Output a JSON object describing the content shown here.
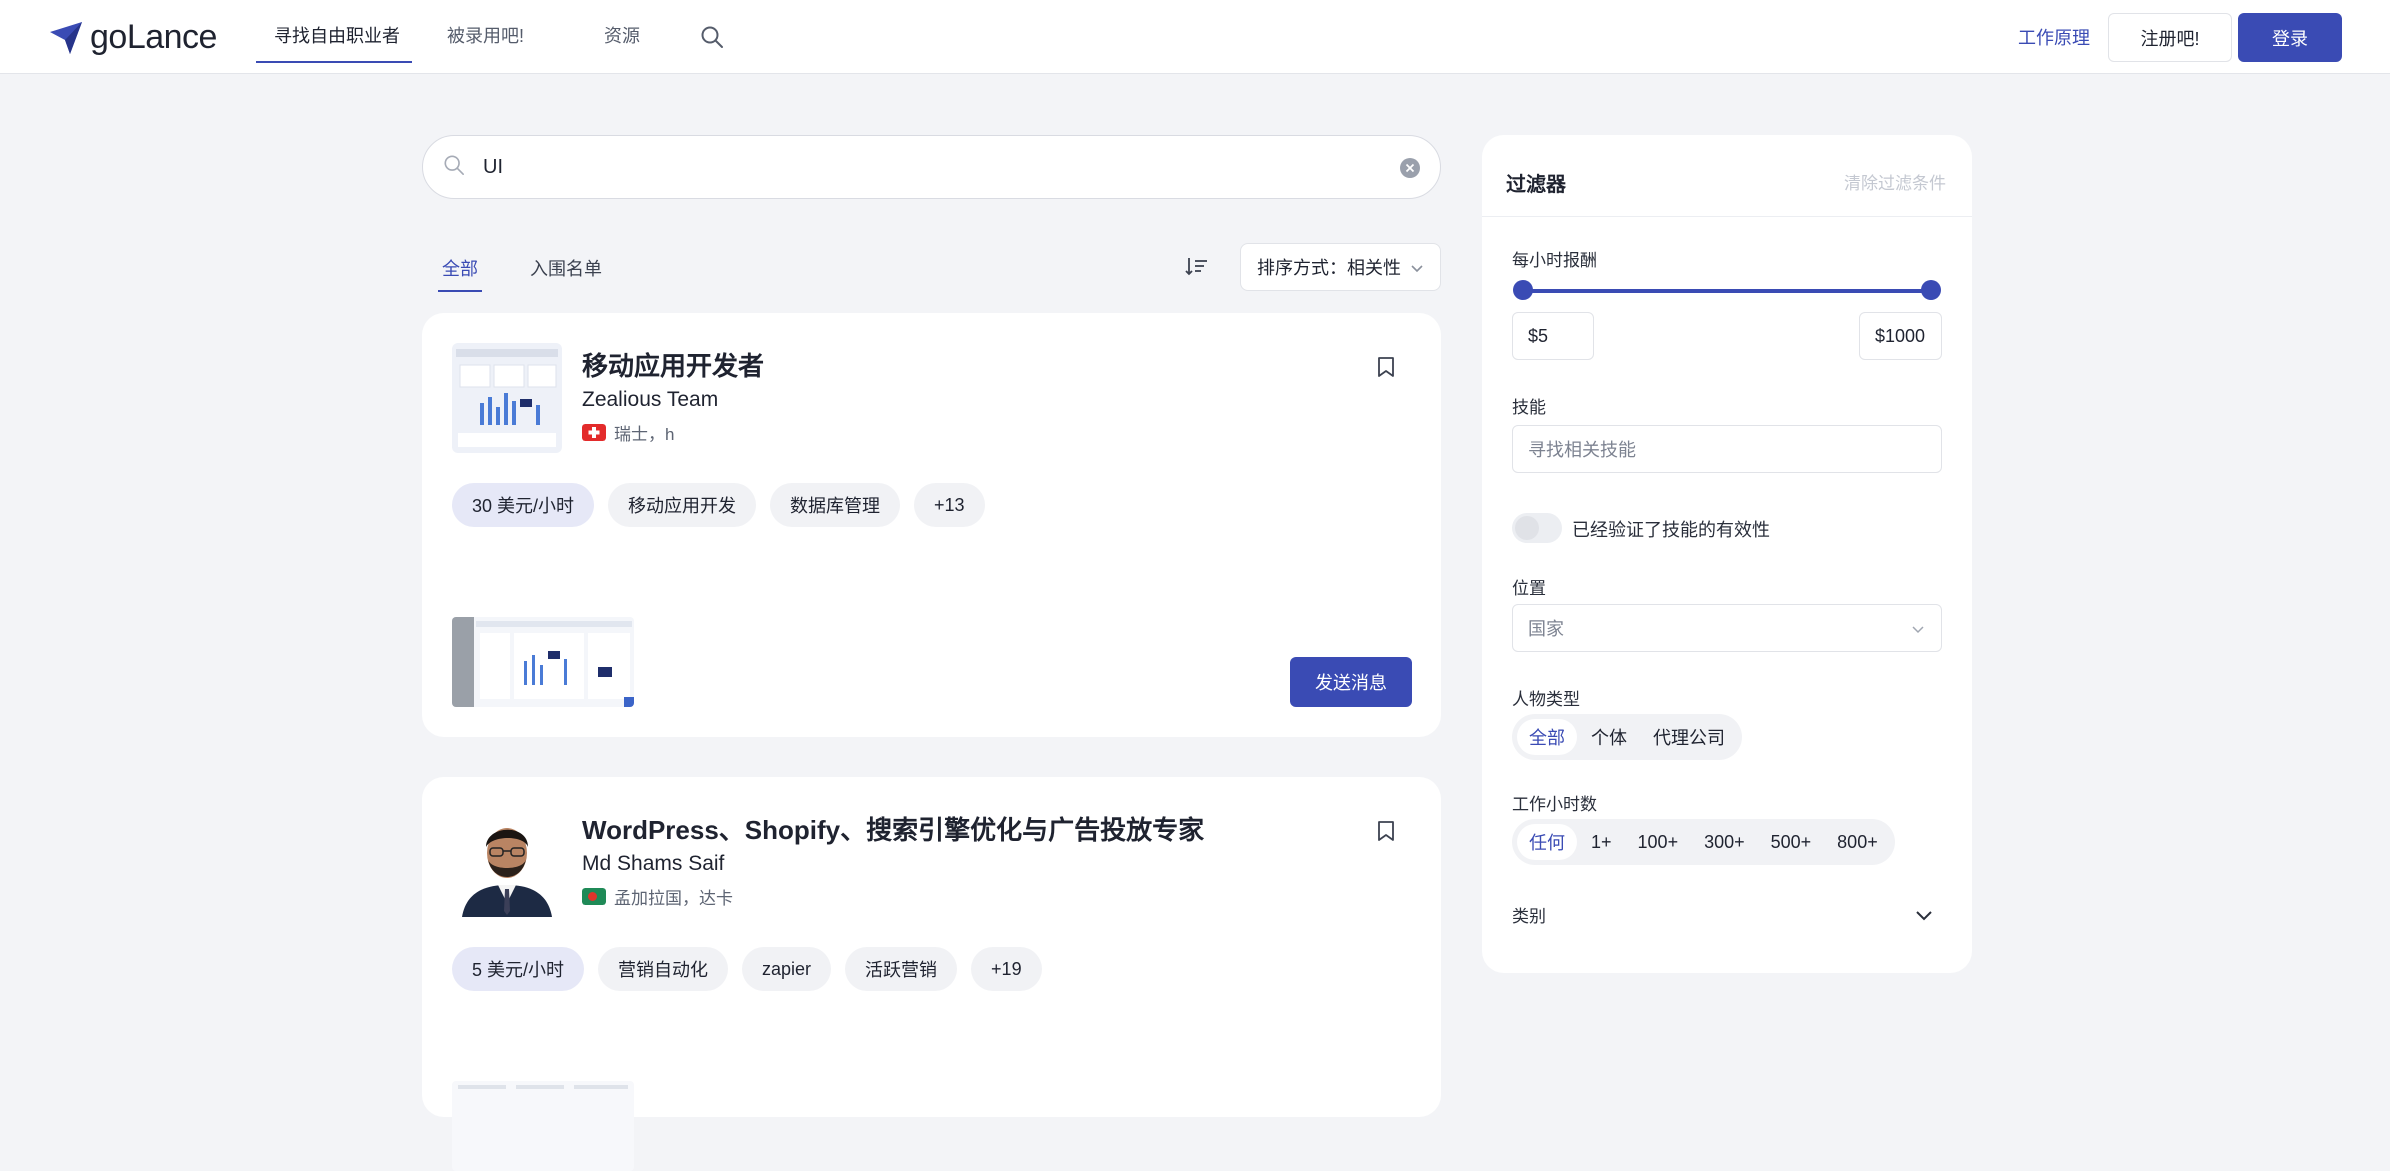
{
  "header": {
    "logo_text": "goLance",
    "nav": [
      "寻找自由职业者",
      "被录用吧!",
      "资源"
    ],
    "how_it_works": "工作原理",
    "register": "注册吧!",
    "login": "登录"
  },
  "search": {
    "value": "UI"
  },
  "tabs": [
    "全部",
    "入围名单"
  ],
  "sort": {
    "label": "排序方式：相关性"
  },
  "cards": [
    {
      "title": "移动应用开发者",
      "name": "Zealious Team",
      "location": "瑞士，h",
      "chips": [
        "30 美元/小时",
        "移动应用开发",
        "数据库管理",
        "+13"
      ],
      "message_button": "发送消息"
    },
    {
      "title": "WordPress、Shopify、搜索引擎优化与广告投放专家",
      "name": "Md Shams Saif",
      "location": "孟加拉国，达卡",
      "chips": [
        "5 美元/小时",
        "营销自动化",
        "zapier",
        "活跃营销",
        "+19"
      ]
    }
  ],
  "filters": {
    "title": "过滤器",
    "clear": "清除过滤条件",
    "hourly_rate_label": "每小时报酬",
    "min_price": "$5",
    "max_price": "$1000",
    "skills_label": "技能",
    "skills_placeholder": "寻找相关技能",
    "verified_label": "已经验证了技能的有效性",
    "location_label": "位置",
    "country_placeholder": "国家",
    "person_type_label": "人物类型",
    "person_types": [
      "全部",
      "个体",
      "代理公司"
    ],
    "hours_label": "工作小时数",
    "hours_options": [
      "任何",
      "1+",
      "100+",
      "300+",
      "500+",
      "800+"
    ],
    "category_label": "类别"
  },
  "colors": {
    "accent": "#3a4bb4",
    "background": "#f3f4f7"
  }
}
